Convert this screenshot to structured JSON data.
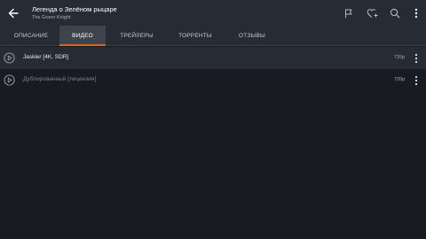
{
  "header": {
    "title": "Легенда о Зелёном рыцаре",
    "subtitle": "The Green Knight",
    "icons": [
      "back-arrow-icon",
      "flag-icon",
      "heart-add-icon",
      "search-icon",
      "more-vertical-icon"
    ]
  },
  "tabs": [
    {
      "label": "ОПИСАНИЕ",
      "active": false
    },
    {
      "label": "ВИДЕО",
      "active": true
    },
    {
      "label": "ТРЕЙЛЕРЫ",
      "active": false
    },
    {
      "label": "ТОРРЕНТЫ",
      "active": false
    },
    {
      "label": "ОТЗЫВЫ",
      "active": false
    }
  ],
  "videos": [
    {
      "label": "Jaskier [4K, SDR]",
      "quality": "720p",
      "enabled": true
    },
    {
      "label": "Дублированный [лицензия]",
      "quality": "720p",
      "enabled": false
    }
  ],
  "colors": {
    "background": "#181b22",
    "toolbar": "#272b34",
    "active_tab": "#3e434d",
    "accent": "#d9661f"
  }
}
